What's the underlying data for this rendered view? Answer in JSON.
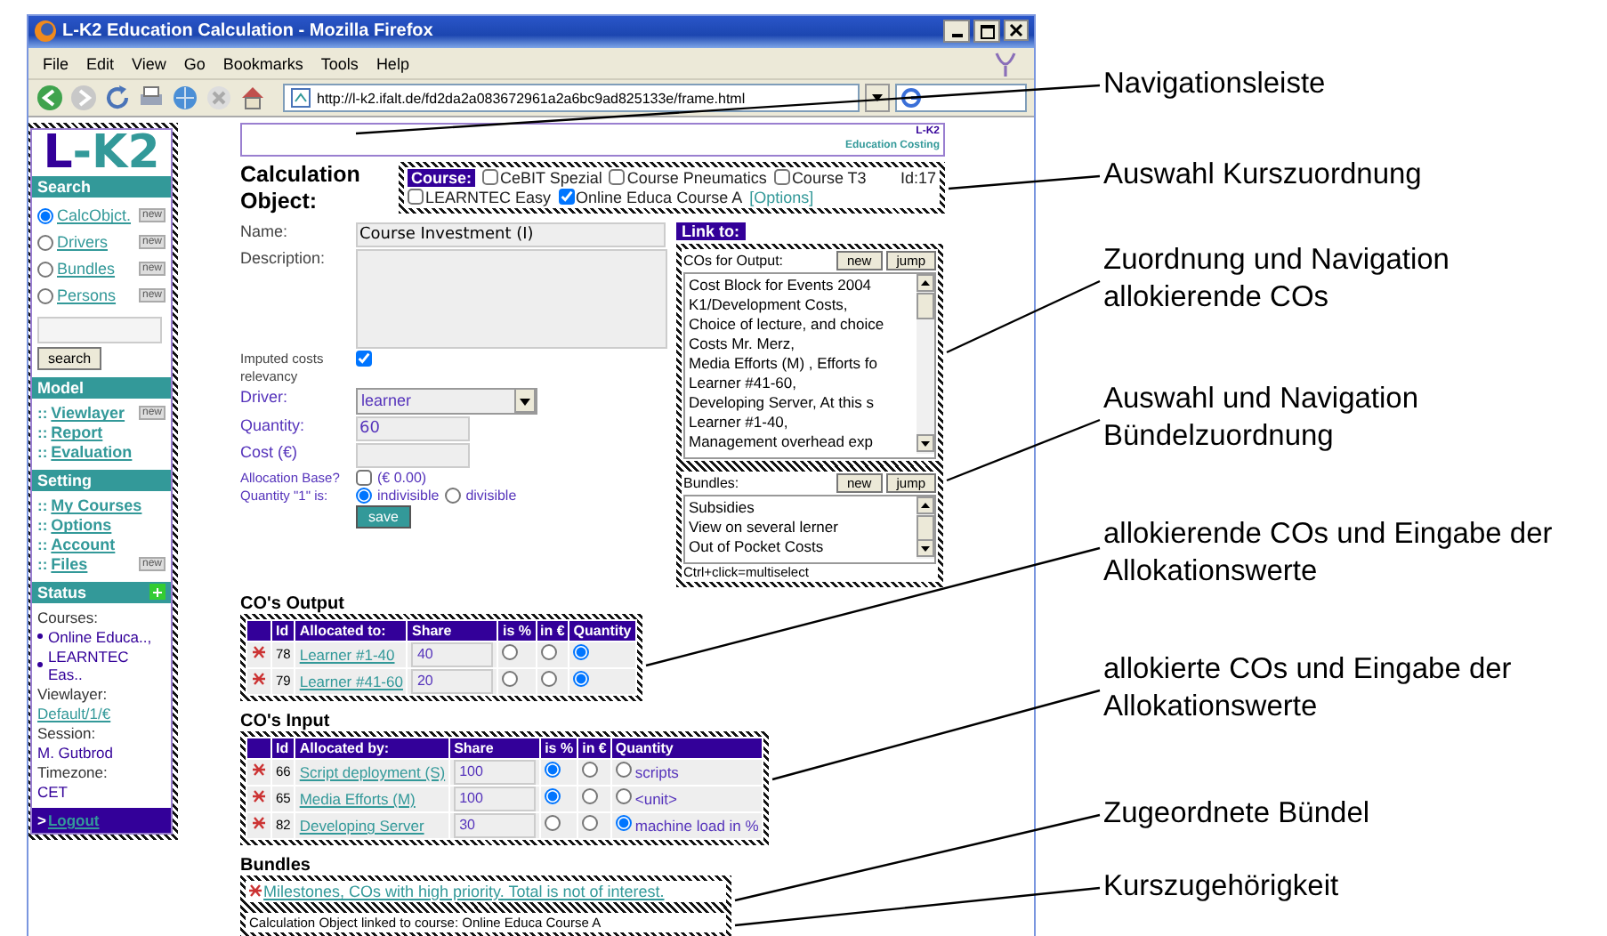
{
  "window": {
    "title": "L-K2 Education Calculation - Mozilla Firefox"
  },
  "menu": [
    "File",
    "Edit",
    "View",
    "Go",
    "Bookmarks",
    "Tools",
    "Help"
  ],
  "address_bar": {
    "value": "http://l-k2.ifalt.de/fd2da2a083672961a2a6bc9ad825133e/frame.html"
  },
  "sidebar": {
    "logo": "L-K2",
    "search": {
      "title": "Search",
      "items": [
        {
          "label": "CalcObjct.",
          "selected": true,
          "badge": "new"
        },
        {
          "label": "Drivers",
          "selected": false,
          "badge": "new"
        },
        {
          "label": "Bundles",
          "selected": false,
          "badge": "new"
        },
        {
          "label": "Persons",
          "selected": false,
          "badge": "new"
        }
      ],
      "button": "search"
    },
    "sections": [
      {
        "title": "Model",
        "items": [
          {
            "prefix": "::",
            "label": "Viewlayer",
            "badge": "new"
          },
          {
            "prefix": "::",
            "label": "Report"
          },
          {
            "prefix": "::",
            "label": "Evaluation"
          }
        ]
      },
      {
        "title": "Setting",
        "items": [
          {
            "prefix": "::",
            "label": "My Courses"
          },
          {
            "prefix": "::",
            "label": "Options"
          },
          {
            "prefix": "::",
            "label": "Account"
          },
          {
            "prefix": "::",
            "label": "Files",
            "badge": "new"
          }
        ]
      }
    ],
    "status": {
      "title": "Status",
      "expanded": true,
      "entries": [
        {
          "kind": "label",
          "text": "Courses:"
        },
        {
          "kind": "bullet",
          "text": "Online Educa..,"
        },
        {
          "kind": "bullet",
          "text": "LEARNTEC Eas.."
        },
        {
          "kind": "label",
          "text": "Viewlayer:"
        },
        {
          "kind": "link",
          "text": "Default/1/€"
        },
        {
          "kind": "label",
          "text": "Session:"
        },
        {
          "kind": "value",
          "text": "M. Gutbrod"
        },
        {
          "kind": "label",
          "text": "Timezone:"
        },
        {
          "kind": "value",
          "text": "CET"
        }
      ]
    },
    "logout": {
      "prefix": ">",
      "label": "Logout"
    }
  },
  "header": {
    "brand": "L-K2",
    "subtitle": "Education Costing"
  },
  "heading": "Calculation Object:",
  "course_box": {
    "label": "Course:",
    "id": "Id:17",
    "options": [
      {
        "label": "CeBIT Spezial",
        "checked": false
      },
      {
        "label": "Course Pneumatics",
        "checked": false
      },
      {
        "label": "Course T3",
        "checked": false
      },
      {
        "label": "LEARNTEC Easy",
        "checked": false
      },
      {
        "label": "Online Educa Course A",
        "checked": true
      }
    ],
    "options_link": "[Options]"
  },
  "form": {
    "name": {
      "label": "Name:",
      "value": "Course Investment (I)"
    },
    "description": {
      "label": "Description:"
    },
    "imputed": {
      "label": "Imputed costs relevancy",
      "checked": true
    },
    "driver": {
      "label": "Driver:",
      "value": "learner"
    },
    "quantity": {
      "label": "Quantity:",
      "value": "60"
    },
    "cost": {
      "label": "Cost (€)"
    },
    "allocation_base": {
      "label": "Allocation Base?",
      "checked": false,
      "amount": "(€ 0.00)"
    },
    "quantity_one": {
      "label": "Quantity \"1\" is:",
      "options": [
        {
          "label": "indivisible",
          "selected": true
        },
        {
          "label": "divisible",
          "selected": false
        }
      ]
    },
    "save": "save"
  },
  "link_to": {
    "title": "Link to:",
    "outputs": {
      "label": "COs for Output:",
      "buttons": [
        "new",
        "jump"
      ],
      "items": [
        "Cost Block for Events 2004",
        "K1/Development Costs,",
        "Choice of lecture, and choice",
        "Costs Mr. Merz,",
        "Media Efforts (M) , Efforts fo",
        "Learner #41-60,",
        "Developing Server, At this s",
        "Learner #1-40,",
        "Management overhead exp"
      ]
    },
    "bundles": {
      "label": "Bundles:",
      "buttons": [
        "new",
        "jump"
      ],
      "items": [
        "Subsidies",
        "View on several lerner",
        "Out of Pocket Costs"
      ]
    },
    "hint": "Ctrl+click=multiselect"
  },
  "output_section": {
    "title": "CO's Output",
    "columns": [
      "Id",
      "Allocated to:",
      "Share",
      "is %",
      "in €",
      "Quantity"
    ],
    "rows": [
      {
        "id": "78",
        "name": "Learner #1-40",
        "share": "40",
        "is_percent": false,
        "in_euro": false,
        "quantity": true
      },
      {
        "id": "79",
        "name": "Learner #41-60",
        "share": "20",
        "is_percent": false,
        "in_euro": false,
        "quantity": true
      }
    ]
  },
  "input_section": {
    "title": "CO's Input",
    "columns": [
      "Id",
      "Allocated by:",
      "Share",
      "is %",
      "in €",
      "Quantity"
    ],
    "rows": [
      {
        "id": "66",
        "name": "Script deployment (S)",
        "share": "100",
        "is_percent": true,
        "in_euro": false,
        "quantity": false,
        "unit": "scripts"
      },
      {
        "id": "65",
        "name": "Media Efforts (M)",
        "share": "100",
        "is_percent": true,
        "in_euro": false,
        "quantity": false,
        "unit": "<unit>"
      },
      {
        "id": "82",
        "name": "Developing Server",
        "share": "30",
        "is_percent": false,
        "in_euro": false,
        "quantity": true,
        "unit": "machine load in %"
      }
    ]
  },
  "bundles_section": {
    "title": "Bundles",
    "items": [
      "Milestones, COs with high priority. Total is not of interest."
    ],
    "footer": "Calculation Object linked to course: Online Educa Course A"
  },
  "annotations": [
    "Navigationsleiste",
    "Auswahl Kurszuordnung",
    "Zuordnung und Navigation allokierende COs",
    "Auswahl und Navigation Bündelzuordnung",
    "allokierende COs und Eingabe der Allokationswerte",
    "allokierte COs und Eingabe der Allokationswerte",
    "Zugeordnete Bündel",
    "Kurszugehörigkeit"
  ]
}
